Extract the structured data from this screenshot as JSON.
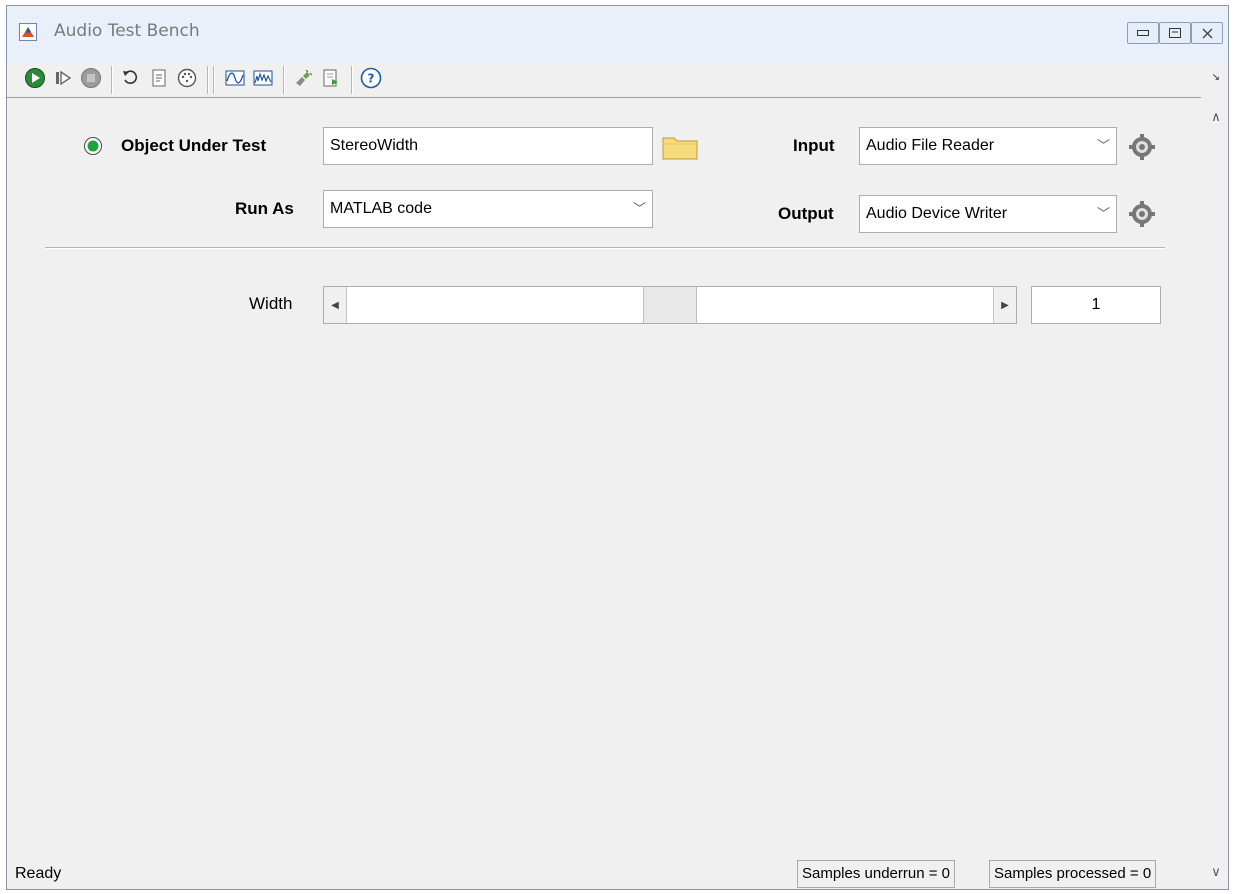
{
  "window": {
    "title": "Audio Test Bench",
    "controls": {
      "minimize": "▭",
      "maximize": "□",
      "close": "✕"
    }
  },
  "toolbar": {
    "icons": [
      "play-icon",
      "step-icon",
      "stop-icon",
      "refresh-icon",
      "generate-code-icon",
      "midi-icon",
      "time-scope-icon",
      "spectrum-analyzer-icon",
      "plugin-generate-icon",
      "export-icon",
      "help-icon"
    ],
    "expand_glyph": "↘"
  },
  "form": {
    "object_under_test": {
      "label": "Object Under Test",
      "value": "StereoWidth"
    },
    "run_as": {
      "label": "Run As",
      "value": "MATLAB code"
    },
    "input": {
      "label": "Input",
      "value": "Audio File Reader"
    },
    "output": {
      "label": "Output",
      "value": "Audio Device Writer"
    }
  },
  "parameters": [
    {
      "label": "Width",
      "value": "1",
      "fraction": 0.5
    }
  ],
  "status": {
    "text": "Ready",
    "underrun": "Samples underrun = 0",
    "processed": "Samples processed = 0"
  },
  "colors": {
    "play_green": "#1e9e3a",
    "indicator_green": "#22a03a",
    "folder_yellow": "#f6dc7a"
  }
}
